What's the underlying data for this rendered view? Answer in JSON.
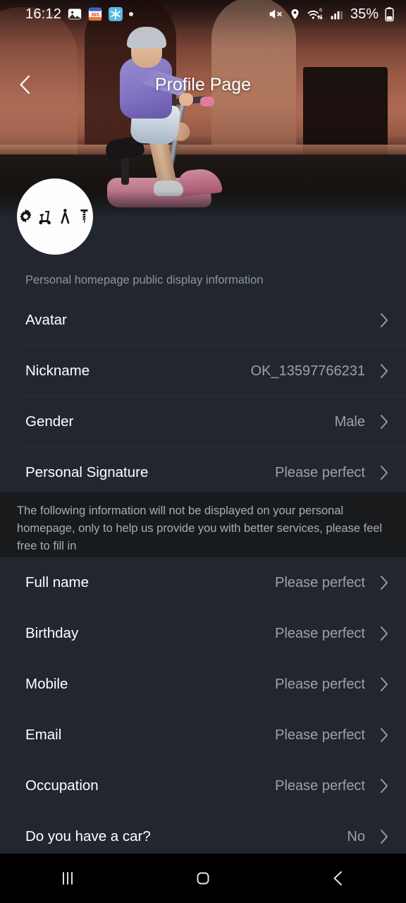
{
  "status_bar": {
    "time": "16:12",
    "battery_percent": "35%",
    "icons": [
      "gallery-icon",
      "calendar-365-icon",
      "snowflake-app-icon",
      "notification-dot",
      "mute-icon",
      "location-icon",
      "wifi-6-icon",
      "cellular-signal-icon",
      "battery-icon"
    ]
  },
  "header": {
    "title": "Profile Page",
    "back_icon": "back-chevron-icon",
    "banner_description": "Woman riding a pink electric scooter in front of a terracotta wall"
  },
  "avatar": {
    "name": "user-avatar",
    "glyphs": [
      "gear-icon",
      "scooter-icon",
      "caliper-icon",
      "screw-icon"
    ],
    "background_color": "#fdfdfd",
    "glyph_color": "#111111"
  },
  "public_section": {
    "label": "Personal homepage public display information",
    "rows": [
      {
        "label": "Avatar",
        "value": "",
        "name": "row-avatar",
        "chevron": "chevron-right-icon"
      },
      {
        "label": "Nickname",
        "value": "OK_13597766231",
        "name": "row-nickname",
        "chevron": "chevron-right-icon"
      },
      {
        "label": "Gender",
        "value": "Male",
        "name": "row-gender",
        "chevron": "chevron-right-icon"
      },
      {
        "label": "Personal Signature",
        "value": "Please perfect",
        "name": "row-personal-signature",
        "chevron": "chevron-right-icon"
      }
    ]
  },
  "notice": {
    "text": "The following information will not be displayed on your personal homepage, only to help us provide you with better services, please feel free to fill in"
  },
  "private_section": {
    "rows": [
      {
        "label": "Full name",
        "value": "Please perfect",
        "name": "row-full-name",
        "chevron": "chevron-right-icon"
      },
      {
        "label": "Birthday",
        "value": "Please perfect",
        "name": "row-birthday",
        "chevron": "chevron-right-icon"
      },
      {
        "label": "Mobile",
        "value": "Please perfect",
        "name": "row-mobile",
        "chevron": "chevron-right-icon"
      },
      {
        "label": "Email",
        "value": "Please perfect",
        "name": "row-email",
        "chevron": "chevron-right-icon"
      },
      {
        "label": "Occupation",
        "value": "Please perfect",
        "name": "row-occupation",
        "chevron": "chevron-right-icon"
      },
      {
        "label": "Do you have a car?",
        "value": "No",
        "name": "row-have-a-car",
        "chevron": "chevron-right-icon"
      }
    ]
  },
  "nav_bar": {
    "recents_icon": "recents-icon",
    "home_icon": "home-icon",
    "back_icon": "back-icon"
  },
  "colors": {
    "page_background": "#22272f",
    "notice_background": "#191a1c",
    "divider": "#2b313a",
    "primary_text": "#ffffff",
    "secondary_text": "#9aa1ab",
    "label_text": "#8e959f",
    "nav_background": "#000000"
  }
}
